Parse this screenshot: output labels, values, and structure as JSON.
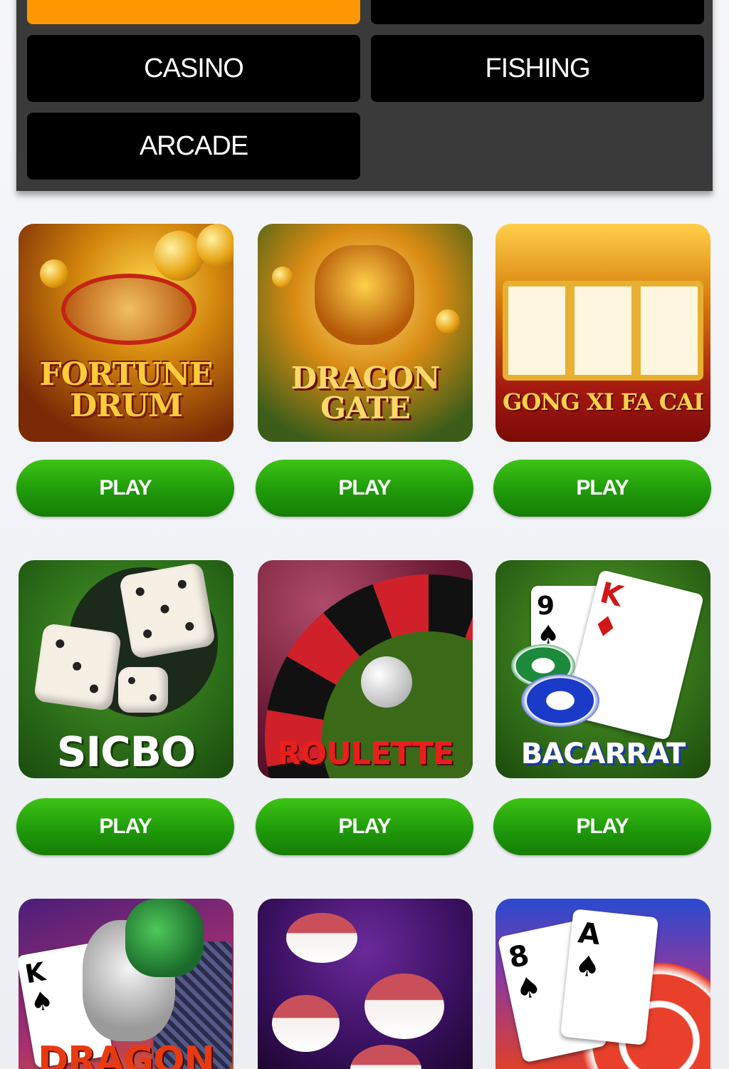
{
  "categories": [
    {
      "label": "",
      "active": true
    },
    {
      "label": "",
      "active": false
    },
    {
      "label": "CASINO",
      "active": false
    },
    {
      "label": "FISHING",
      "active": false
    },
    {
      "label": "ARCADE",
      "active": false
    }
  ],
  "games": [
    {
      "title": "FORTUNE DRUM",
      "play_label": "PLAY"
    },
    {
      "title": "DRAGON GATE",
      "play_label": "PLAY"
    },
    {
      "title": "GONG XI FA CAI",
      "play_label": "PLAY"
    },
    {
      "title": "SICBO",
      "play_label": "PLAY"
    },
    {
      "title": "ROULETTE",
      "play_label": "PLAY"
    },
    {
      "title": "BACARRAT",
      "play_label": "PLAY"
    },
    {
      "title": "DRAGON",
      "play_label": ""
    },
    {
      "title": "",
      "play_label": ""
    },
    {
      "title": "",
      "play_label": ""
    }
  ],
  "colors": {
    "active_category": "#ff9800",
    "category_button": "#000000",
    "play_button": "#1f9a0a"
  }
}
